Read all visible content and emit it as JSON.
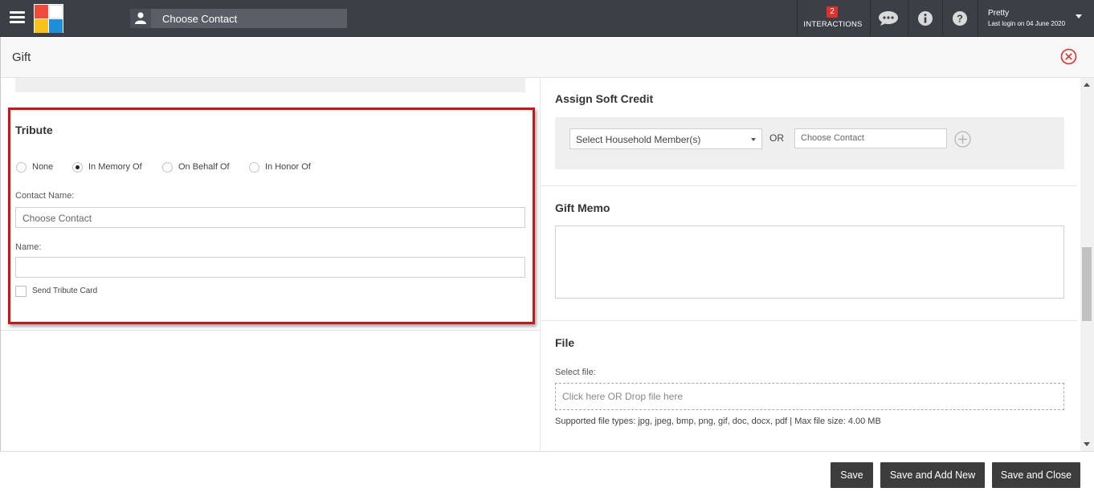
{
  "topbar": {
    "search_placeholder": "Choose Contact",
    "interactions_count": "2",
    "interactions_label": "INTERACTIONS",
    "user_name": "Pretty",
    "last_login": "Last login on 04 June 2020"
  },
  "modal": {
    "title": "Gift"
  },
  "tribute": {
    "title": "Tribute",
    "options": [
      "None",
      "In Memory Of",
      "On Behalf Of",
      "In Honor Of"
    ],
    "selected": "In Memory Of",
    "contact_name_label": "Contact Name:",
    "contact_placeholder": "Choose Contact",
    "name_label": "Name:",
    "name_value": "",
    "send_card_label": "Send Tribute Card"
  },
  "soft_credit": {
    "title": "Assign Soft Credit",
    "household_select": "Select Household Member(s)",
    "or_label": "OR",
    "contact_placeholder": "Choose Contact"
  },
  "gift_memo": {
    "title": "Gift Memo",
    "value": ""
  },
  "file": {
    "title": "File",
    "select_label": "Select file:",
    "dropzone_text": "Click here OR Drop file here",
    "help_text": "Supported file types: jpg, jpeg, bmp, png, gif, doc, docx, pdf | Max file size: 4.00 MB"
  },
  "footer": {
    "save": "Save",
    "save_add_new": "Save and Add New",
    "save_close": "Save and Close"
  },
  "colors": {
    "topbar": "#3b3f46",
    "highlight_border": "#cc1517",
    "button": "#3c3c3c",
    "close_icon": "#e0302b"
  }
}
